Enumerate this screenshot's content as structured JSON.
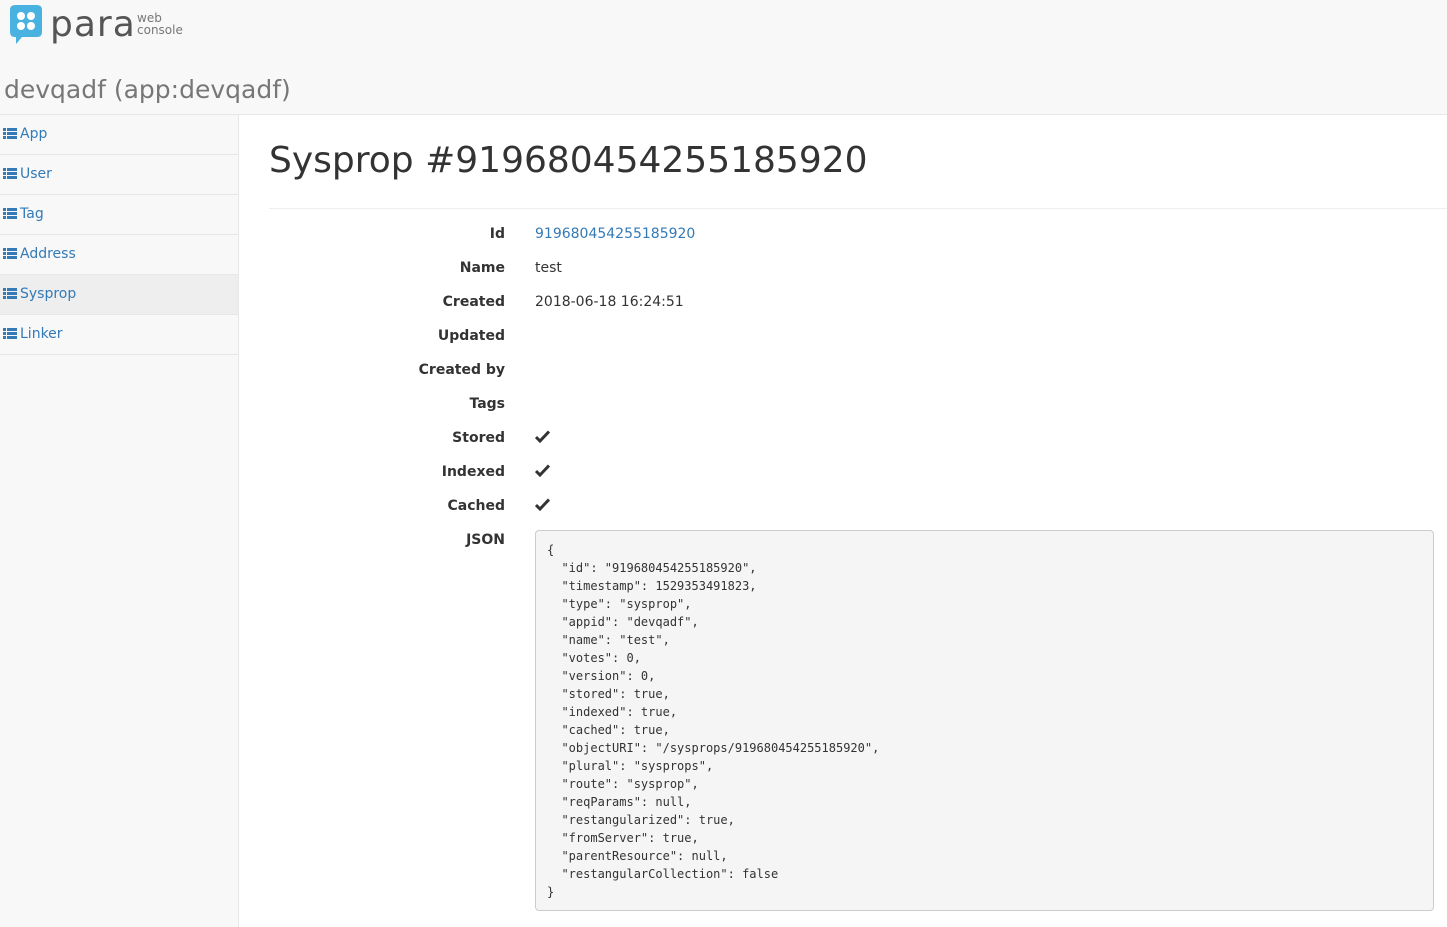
{
  "brand": {
    "name": "para",
    "sub_line1": "web",
    "sub_line2": "console",
    "color": "#4ab2e0"
  },
  "app": {
    "title": "devqadf (app:devqadf)"
  },
  "sidebar": {
    "items": [
      {
        "label": "App",
        "icon": "list-icon",
        "active": false
      },
      {
        "label": "User",
        "icon": "list-icon",
        "active": false
      },
      {
        "label": "Tag",
        "icon": "list-icon",
        "active": false
      },
      {
        "label": "Address",
        "icon": "list-icon",
        "active": false
      },
      {
        "label": "Sysprop",
        "icon": "list-icon",
        "active": true
      },
      {
        "label": "Linker",
        "icon": "list-icon",
        "active": false
      }
    ]
  },
  "main": {
    "title": "Sysprop #919680454255185920",
    "properties": [
      {
        "label": "Id",
        "value": "919680454255185920",
        "link": true
      },
      {
        "label": "Name",
        "value": "test"
      },
      {
        "label": "Created",
        "value": "2018-06-18 16:24:51"
      },
      {
        "label": "Updated",
        "value": ""
      },
      {
        "label": "Created by",
        "value": ""
      },
      {
        "label": "Tags",
        "value": ""
      },
      {
        "label": "Stored",
        "value": true,
        "icon": "check-icon"
      },
      {
        "label": "Indexed",
        "value": true,
        "icon": "check-icon"
      },
      {
        "label": "Cached",
        "value": true,
        "icon": "check-icon"
      },
      {
        "label": "JSON"
      }
    ],
    "json_text": "{\n  \"id\": \"919680454255185920\",\n  \"timestamp\": 1529353491823,\n  \"type\": \"sysprop\",\n  \"appid\": \"devqadf\",\n  \"name\": \"test\",\n  \"votes\": 0,\n  \"version\": 0,\n  \"stored\": true,\n  \"indexed\": true,\n  \"cached\": true,\n  \"objectURI\": \"/sysprops/919680454255185920\",\n  \"plural\": \"sysprops\",\n  \"route\": \"sysprop\",\n  \"reqParams\": null,\n  \"restangularized\": true,\n  \"fromServer\": true,\n  \"parentResource\": null,\n  \"restangularCollection\": false\n}"
  },
  "colors": {
    "link": "#337ab7",
    "sidebar_bg": "#f8f8f8",
    "active_bg": "#eeeeee",
    "code_bg": "#f5f5f5"
  }
}
